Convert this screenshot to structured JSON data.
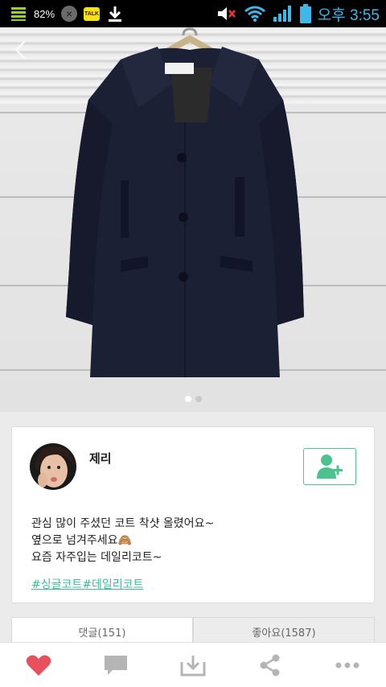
{
  "status_bar": {
    "battery_percent": "82%",
    "time": "오후 3:55",
    "kakaotalk_label": "TALK"
  },
  "photo": {
    "page_count": 2,
    "active_page": 1
  },
  "post": {
    "username": "제리",
    "lines": [
      "관심 많이 주셨던 코트 착샷 올렸어요~",
      "옆으로 넘겨주세요🙈",
      "요즘 자주입는 데일리코트~"
    ],
    "hashtags": "#싱글코트#데일리코트"
  },
  "tabs": [
    {
      "label": "댓글(151)"
    },
    {
      "label": "좋아요(1587)"
    }
  ],
  "colors": {
    "accent_green": "#4cc28f",
    "hashtag": "#3fbca0",
    "like_red": "#e8505b",
    "toolbar_icon": "#b5b5b5"
  },
  "toolbar": {
    "icons": [
      "heart-icon",
      "comment-icon",
      "download-icon",
      "share-icon",
      "more-icon"
    ]
  }
}
